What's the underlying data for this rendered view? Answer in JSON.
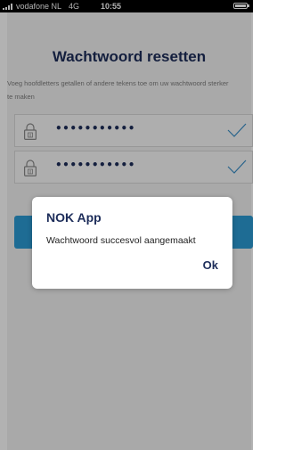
{
  "status_bar": {
    "carrier": "vodafone NL",
    "network": "4G",
    "time": "10:55",
    "battery_level": 1.0
  },
  "page": {
    "title": "Wachtwoord resetten",
    "subtitle": "Voeg hoofdletters getallen of andere tekens toe om uw wachtwoord sterker te maken",
    "password_field_1": {
      "value": "•••••••••••",
      "icon": "lock-icon",
      "status_icon": "checkmark-icon"
    },
    "password_field_2": {
      "value": "•••••••••••",
      "icon": "lock-icon",
      "status_icon": "checkmark-icon"
    }
  },
  "dialog": {
    "title": "NOK App",
    "message": "Wachtwoord succesvol aangemaakt",
    "ok_label": "Ok"
  },
  "colors": {
    "title": "#1d2d5a",
    "accent": "#2c9bd5",
    "check": "#3a8fc8",
    "background": "#f2f2f2"
  }
}
